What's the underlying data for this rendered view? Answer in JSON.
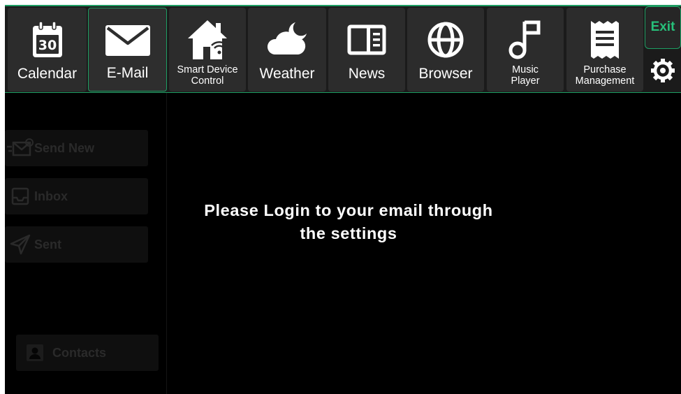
{
  "topbar": {
    "tiles": [
      {
        "label": "Calendar",
        "icon": "calendar-icon",
        "icon_text": "30"
      },
      {
        "label": "E-Mail",
        "icon": "mail-icon"
      },
      {
        "label": "Smart Device Control",
        "line1": "Smart Device",
        "line2": "Control",
        "icon": "smart-home-icon"
      },
      {
        "label": "Weather",
        "icon": "weather-icon"
      },
      {
        "label": "News",
        "icon": "news-icon"
      },
      {
        "label": "Browser",
        "icon": "globe-icon"
      },
      {
        "label": "Music Player",
        "line1": "Music",
        "line2": "Player",
        "icon": "music-note-icon"
      },
      {
        "label": "Purchase Management",
        "line1": "Purchase",
        "line2": "Management",
        "icon": "receipt-icon"
      }
    ],
    "active_tile": "E-Mail",
    "exit_label": "Exit",
    "settings_icon": "gear-icon"
  },
  "sidebar": {
    "send_new": "Send New",
    "inbox": "Inbox",
    "sent": "Sent",
    "contacts": "Contacts"
  },
  "main": {
    "message_line1": "Please Login to your email through",
    "message_line2": "the settings"
  },
  "colors": {
    "accent": "#1e9e63",
    "exit_text": "#27c07a",
    "background": "#000000",
    "tile": "#2c2c2c"
  }
}
